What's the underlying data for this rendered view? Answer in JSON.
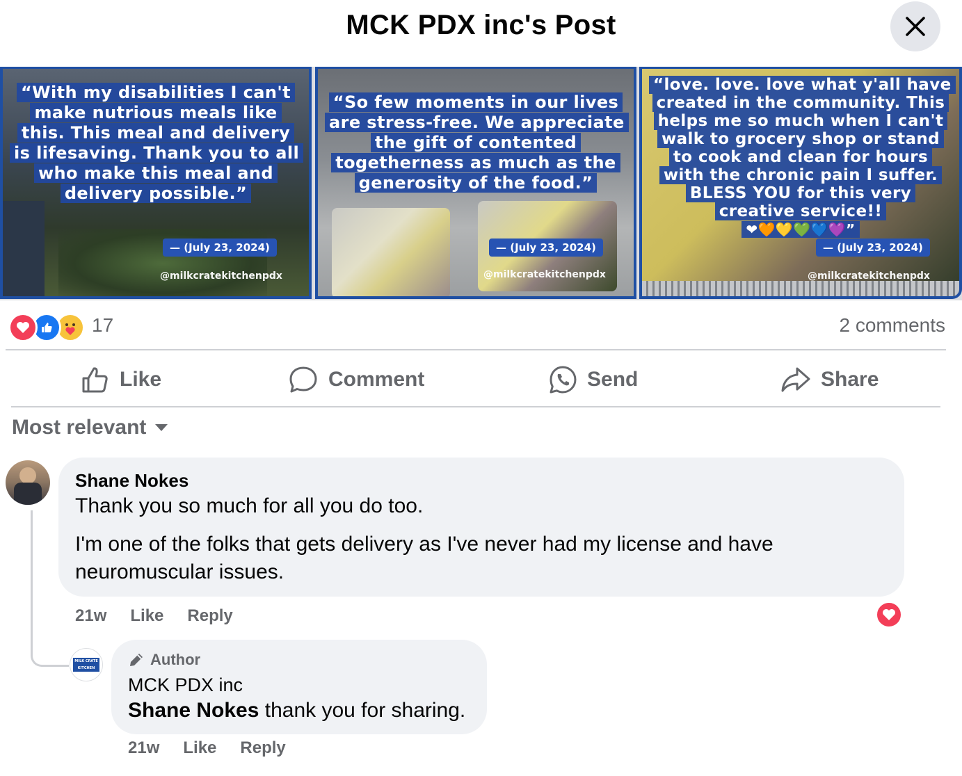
{
  "header": {
    "title": "MCK PDX inc's Post",
    "close_icon": "close-icon"
  },
  "media": {
    "tiles": [
      {
        "quote": "“With my disabilities I can't make nutrious meals like this. This meal and delivery is lifesaving. Thank you to all who make this meal and delivery possible.”",
        "date": "— (July 23, 2024)",
        "handle": "@milkcratekitchenpdx"
      },
      {
        "quote": "“So few moments in our lives are stress-free. We appreciate the gift of contented togetherness as much as the generosity of the food.”",
        "date": "— (July 23, 2024)",
        "handle": "@milkcratekitchenpdx"
      },
      {
        "quote": "“love. love. love what y'all have created in the community. This helps me so much when I can't walk to grocery shop or stand to cook and clean for hours with the chronic pain I suffer. BLESS YOU for this very creative service!!",
        "hearts": "❤🧡💛💚💙💜”",
        "date": "— (July 23, 2024)",
        "handle": "@milkcratekitchenpdx"
      }
    ]
  },
  "reactions": {
    "count": "17",
    "comments": "2 comments",
    "icons": [
      "love-icon",
      "like-icon",
      "care-icon"
    ]
  },
  "actions": {
    "like": "Like",
    "comment": "Comment",
    "send": "Send",
    "share": "Share"
  },
  "sort": {
    "label": "Most relevant"
  },
  "comments": [
    {
      "author": "Shane Nokes",
      "paragraph1": "Thank you so much for all you do too.",
      "paragraph2": "I'm one of the folks that gets delivery as I've never had my license and have neuromuscular issues.",
      "time": "21w",
      "like": "Like",
      "reply": "Reply",
      "reply_comment": {
        "badge": "Author",
        "author": "MCK PDX inc",
        "mention": "Shane Nokes",
        "text": " thank you for sharing.",
        "time": "21w",
        "like": "Like",
        "reply": "Reply",
        "avatar_text": "MILK CRATE KITCHEN"
      }
    }
  ],
  "colors": {
    "accent": "#1877f2",
    "secondary_text": "#65676b",
    "bubble": "#f0f2f5",
    "love": "#f33e58",
    "tile_blue": "#2148a0"
  }
}
